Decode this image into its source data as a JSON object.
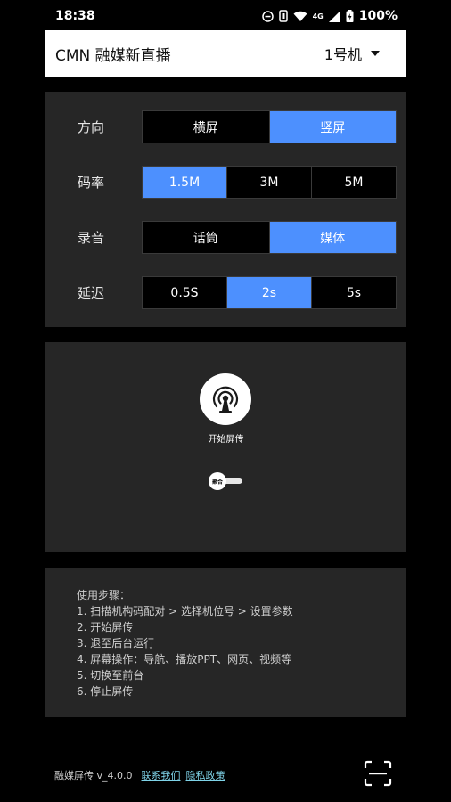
{
  "status_bar": {
    "time": "18:38",
    "network": "4G",
    "battery": "100%"
  },
  "header": {
    "title": "CMN 融媒新直播",
    "device_selector": "1号机"
  },
  "settings": {
    "orientation": {
      "label": "方向",
      "options": [
        "横屏",
        "竖屏"
      ],
      "selected_index": 1
    },
    "bitrate": {
      "label": "码率",
      "options": [
        "1.5M",
        "3M",
        "5M"
      ],
      "selected_index": 0
    },
    "audio": {
      "label": "录音",
      "options": [
        "话筒",
        "媒体"
      ],
      "selected_index": 1
    },
    "latency": {
      "label": "延迟",
      "options": [
        "0.5S",
        "2s",
        "5s"
      ],
      "selected_index": 1
    }
  },
  "cast": {
    "start_label": "开始屏传",
    "toggle_label": "聚合",
    "toggle_on": false
  },
  "instructions": {
    "title": "使用步骤：",
    "steps": [
      "1. 扫描机构码配对 > 选择机位号 > 设置参数",
      "2. 开始屏传",
      "3. 退至后台运行",
      "4. 屏幕操作：导航、播放PPT、网页、视频等",
      "5. 切换至前台",
      "6. 停止屏传"
    ]
  },
  "footer": {
    "version": "融媒屏传 v_4.0.0",
    "contact_link": "联系我们",
    "privacy_link": "隐私政策"
  },
  "colors": {
    "accent": "#4d90fe",
    "panel": "#262626",
    "background": "#000000",
    "link": "#7fd3e8"
  },
  "icons": {
    "cast": "broadcast-tower-icon",
    "scan": "scan-frame-icon"
  }
}
